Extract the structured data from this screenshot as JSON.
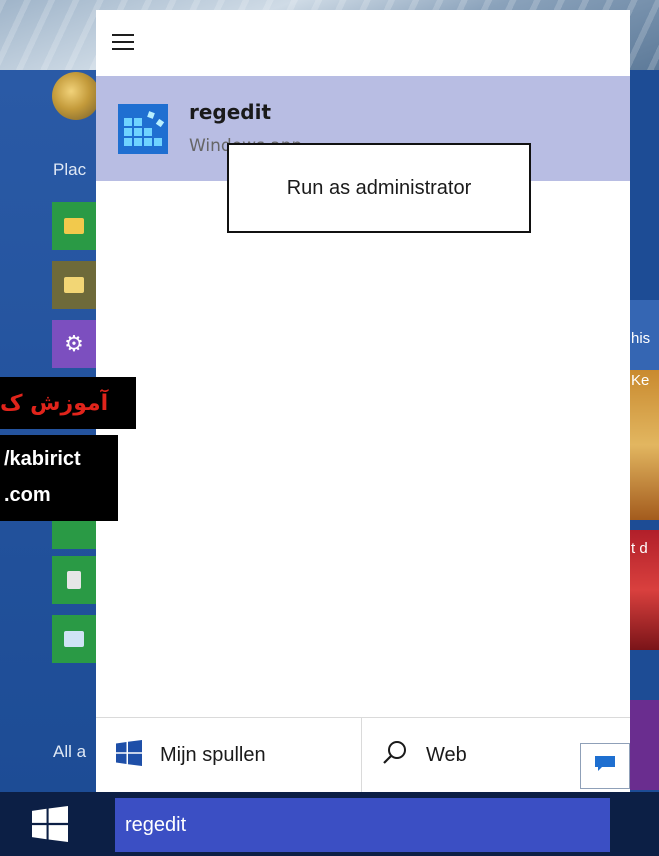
{
  "background": {
    "left_labels": {
      "places": "Plac",
      "all_apps": "All a"
    },
    "right_texts": {
      "a": "his",
      "b": "Ke",
      "c": "t d"
    }
  },
  "start_menu": {
    "menu_icon": "hamburger-icon",
    "result": {
      "title": "regedit",
      "subtitle": "Windows app",
      "icon": "regedit-icon"
    },
    "context_menu": {
      "item": "Run as administrator"
    },
    "bottom": {
      "my_stuff_label": "Mijn spullen",
      "my_stuff_icon": "windows-logo-icon",
      "web_label": "Web",
      "web_icon": "search-icon",
      "feedback_icon": "feedback-icon"
    }
  },
  "watermark": {
    "line1": "آموزش ک",
    "line2": "/kabirict",
    "line3": ".com"
  },
  "taskbar": {
    "start_icon": "windows-logo-icon",
    "search_value": "regedit"
  },
  "colors": {
    "result_highlight": "#b8bde3",
    "search_box": "#3b4fc4",
    "taskbar": "#0c1f45",
    "start_background": "#1f4f97",
    "watermark_red": "#e1241b"
  }
}
